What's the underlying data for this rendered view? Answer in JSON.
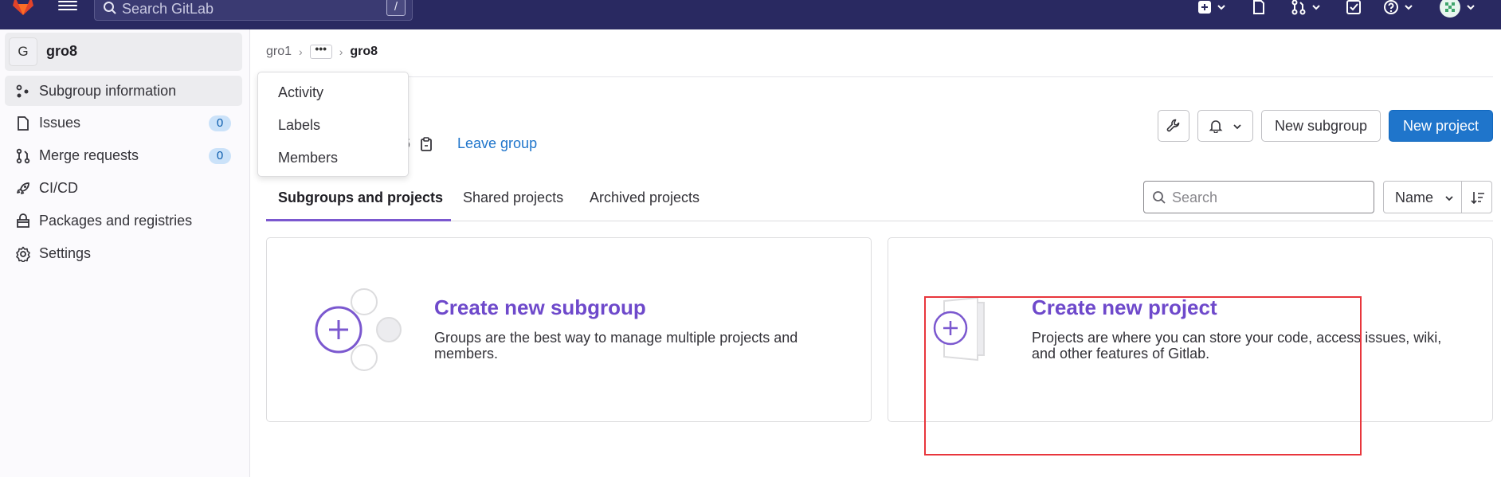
{
  "topbar": {
    "search_placeholder": "Search GitLab",
    "search_shortcut": "/",
    "colors": {
      "bg": "#292961",
      "logo": "#e2432a"
    }
  },
  "sidebar": {
    "group_initial": "G",
    "group_name": "gro8",
    "items": [
      {
        "label": "Subgroup information",
        "icon": "subgroup-icon",
        "active": true
      },
      {
        "label": "Issues",
        "icon": "issues-icon",
        "badge": "0"
      },
      {
        "label": "Merge requests",
        "icon": "merge-request-icon",
        "badge": "0"
      },
      {
        "label": "CI/CD",
        "icon": "rocket-icon"
      },
      {
        "label": "Packages and registries",
        "icon": "package-icon"
      },
      {
        "label": "Settings",
        "icon": "settings-icon"
      }
    ]
  },
  "breadcrumb": {
    "root": "gro1",
    "more": "•••",
    "current": "gro8"
  },
  "dropdown": {
    "items": [
      "Activity",
      "Labels",
      "Members"
    ]
  },
  "group_meta": {
    "id_fragment": "6",
    "leave_label": "Leave group"
  },
  "header_buttons": {
    "new_subgroup": "New subgroup",
    "new_project": "New project"
  },
  "tabs": {
    "items": [
      "Subgroups and projects",
      "Shared projects",
      "Archived projects"
    ],
    "active": "Subgroups and projects"
  },
  "filter": {
    "search_placeholder": "Search",
    "sort_label": "Name"
  },
  "cards": {
    "subgroup": {
      "title": "Create new subgroup",
      "description": "Groups are the best way to manage multiple projects and members."
    },
    "project": {
      "title": "Create new project",
      "description": "Projects are where you can store your code, access issues, wiki, and other features of Gitlab."
    }
  },
  "annotation": {
    "color": "#e8363c"
  }
}
